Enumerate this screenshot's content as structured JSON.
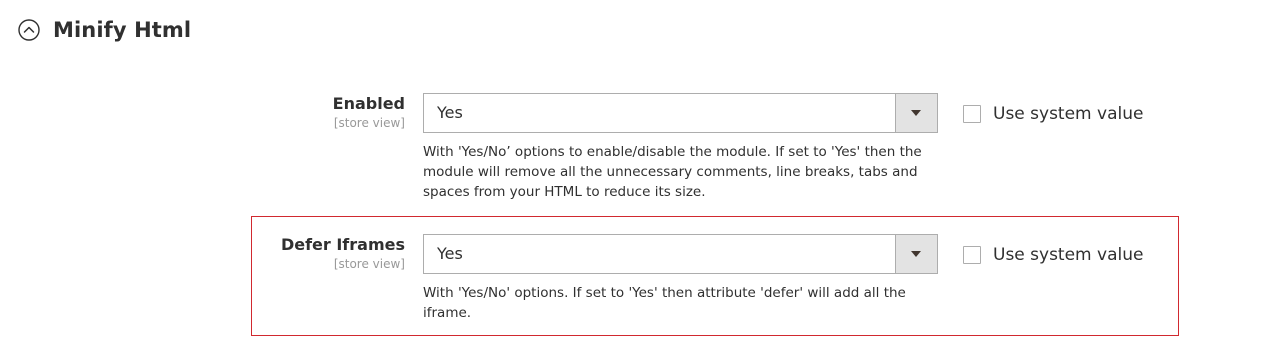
{
  "section": {
    "title": "Minify Html",
    "collapse_icon": "chevron-up-circle-icon"
  },
  "fields": [
    {
      "label": "Enabled",
      "scope": "[store view]",
      "value": "Yes",
      "use_system_value_label": "Use system value",
      "use_system_value_checked": false,
      "note": "With 'Yes/No’ options to enable/disable the module. If set to 'Yes' then the module will remove all the unnecessary comments, line breaks, tabs and spaces from your HTML to reduce its size."
    },
    {
      "label": "Defer Iframes",
      "scope": "[store view]",
      "value": "Yes",
      "use_system_value_label": "Use system value",
      "use_system_value_checked": false,
      "note": "With 'Yes/No' options. If set to 'Yes' then attribute 'defer' will add all the iframe.",
      "highlighted": true,
      "highlight_color": "#d1292f"
    }
  ]
}
